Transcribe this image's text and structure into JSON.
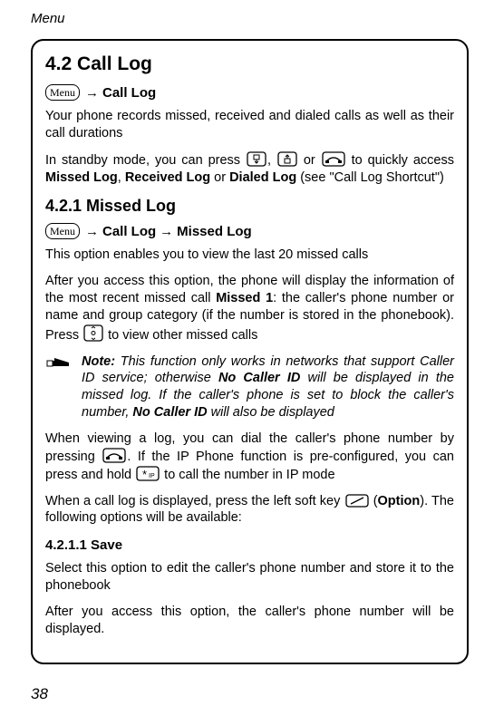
{
  "header": "Menu",
  "section": {
    "title": "4.2 Call Log",
    "nav1_menu": "Menu",
    "nav1_text": "Call Log",
    "p1": "Your phone records missed, received and dialed calls as well as their call durations",
    "p2a": "In standby mode, you can press ",
    "p2b": ", ",
    "p2c": " or ",
    "p2d": " to quickly access ",
    "p2_bold1": "Missed Log",
    "p2e": ", ",
    "p2_bold2": "Received Log",
    "p2f": " or ",
    "p2_bold3": "Dialed Log",
    "p2g": " (see \"Call Log Shortcut\")"
  },
  "sub1": {
    "title": "4.2.1 Missed Log",
    "nav_menu": "Menu",
    "nav_t1": "Call Log",
    "nav_t2": "Missed Log",
    "p1": "This option enables you to view the last 20 missed calls",
    "p2a": "After you access this option, the phone will display the information of the most recent missed call ",
    "p2_bold": "Missed 1",
    "p2b": ": the caller's phone number or name and group category (if the number is stored in the phonebook). Press ",
    "p2c": " to view other missed calls",
    "note_label": "Note:",
    "note_a": " This function only works in networks that support Caller ID service; otherwise ",
    "note_b1": "No Caller ID",
    "note_b": " will be displayed in the missed log. If the caller's phone is set to block the caller's number, ",
    "note_b2": "No Caller ID",
    "note_c": " will also be displayed",
    "p3a": "When viewing a log, you can dial the caller's phone number by pressing ",
    "p3b": ". If the IP Phone function is pre-configured, you can press and hold ",
    "p3c": " to call the number in IP mode",
    "p4a": "When a call log is displayed, press the left soft key ",
    "p4b": " (",
    "p4_bold": "Option",
    "p4c": "). The following options will be available:"
  },
  "sub2": {
    "title": "4.2.1.1 Save",
    "p1": "Select this option to edit the caller's phone number and store it to the phonebook",
    "p2": "After you access this option, the caller's phone number will be displayed."
  },
  "pagenum": "38"
}
